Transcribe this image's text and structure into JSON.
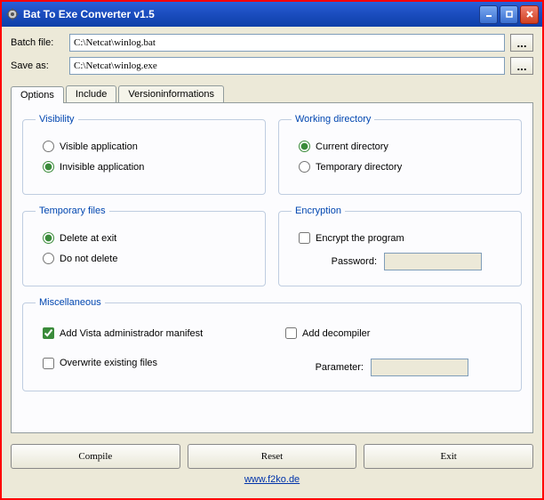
{
  "window": {
    "title": "Bat To Exe Converter v1.5"
  },
  "fields": {
    "batch_label": "Batch file:",
    "batch_value": "C:\\Netcat\\winlog.bat",
    "save_label": "Save as:",
    "save_value": "C:\\Netcat\\winlog.exe",
    "browse": "..."
  },
  "tabs": {
    "options": "Options",
    "include": "Include",
    "version": "Versioninformations"
  },
  "groups": {
    "visibility": {
      "legend": "Visibility",
      "visible": "Visible application",
      "invisible": "Invisible application"
    },
    "working": {
      "legend": "Working directory",
      "current": "Current directory",
      "temp": "Temporary directory"
    },
    "tempfiles": {
      "legend": "Temporary files",
      "delete": "Delete at exit",
      "keep": "Do not delete"
    },
    "encryption": {
      "legend": "Encryption",
      "encrypt": "Encrypt the program",
      "password": "Password:"
    },
    "misc": {
      "legend": "Miscellaneous",
      "vista": "Add Vista administrador manifest",
      "overwrite": "Overwrite existing files",
      "decompiler": "Add decompiler",
      "parameter": "Parameter:"
    }
  },
  "buttons": {
    "compile": "Compile",
    "reset": "Reset",
    "exit": "Exit"
  },
  "footer": {
    "link": "www.f2ko.de"
  }
}
